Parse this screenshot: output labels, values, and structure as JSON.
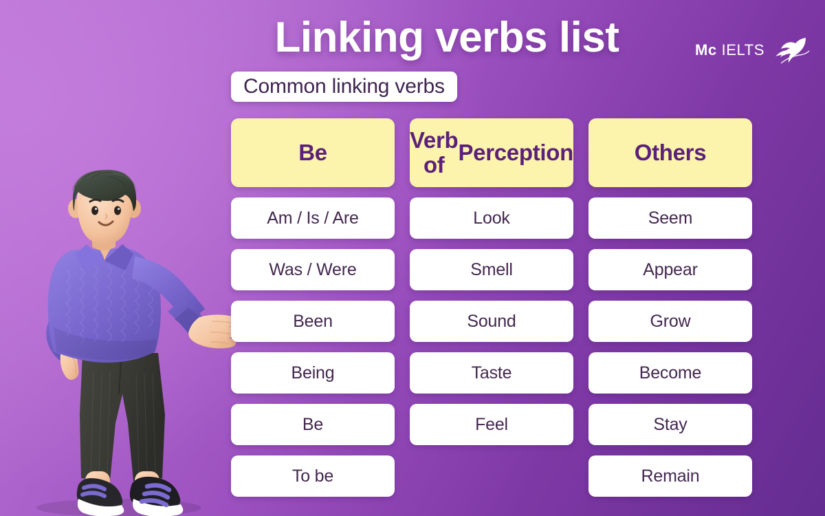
{
  "header": {
    "title": "Linking verbs list",
    "subtitle": "Common linking verbs"
  },
  "logo": {
    "brand_bold": "Mc",
    "brand_light": "IELTS",
    "icon": "hummingbird-icon"
  },
  "theme": {
    "bg_gradient_start": "#bb76d6",
    "bg_gradient_end": "#642c91",
    "header_cell_bg": "#fcf3ad",
    "header_text": "#5b2178",
    "cell_bg": "#ffffff",
    "cell_text": "#43274f",
    "title_text": "#ffffff"
  },
  "table": {
    "columns": [
      {
        "header": "Be",
        "items": [
          "Am / Is / Are",
          "Was / Were",
          "Been",
          "Being",
          "Be",
          "To be"
        ]
      },
      {
        "header": "Verb of Perception",
        "header_line1": "Verb of",
        "header_line2": "Perception",
        "items": [
          "Look",
          "Smell",
          "Sound",
          "Taste",
          "Feel"
        ]
      },
      {
        "header": "Others",
        "items": [
          "Seem",
          "Appear",
          "Grow",
          "Become",
          "Stay",
          "Remain"
        ]
      }
    ]
  },
  "illustration": {
    "name": "3d-boy-presenting",
    "hair_color": "#3a4238",
    "sweater_color": "#7b6ad0",
    "pants_color": "#3a3a38",
    "skin_color": "#f6c9a8",
    "shoe_color": "#27272b"
  }
}
